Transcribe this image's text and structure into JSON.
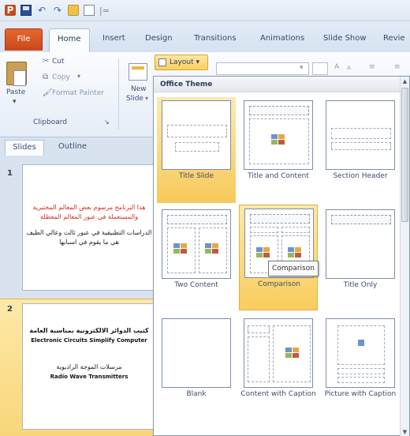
{
  "qat": {
    "separator": "|="
  },
  "tabs": {
    "file": "File",
    "home": "Home",
    "insert": "Insert",
    "design": "Design",
    "transitions": "Transitions",
    "animations": "Animations",
    "slide_show": "Slide Show",
    "review": "Revie"
  },
  "ribbon": {
    "cut": "Cut",
    "copy": "Copy",
    "paste": "Paste",
    "format_painter": "Format Painter",
    "new_slide_line1": "New",
    "new_slide_line2": "Slide",
    "clipboard_group": "Clipboard",
    "layout_button": "Layout"
  },
  "left_pane": {
    "tab_slides": "Slides",
    "tab_outline": "Outline",
    "slides": [
      {
        "number": "1",
        "line1": "هذا البرنامج مرسوم بعض المعالم المختبرية",
        "line2": "والمستعملة في عبور المعالم المعطلة",
        "line3": "الدراسات التطبيقية في عبور ثالث وعالي الطيف",
        "line4": "هي ما يقوم في اسبابها"
      },
      {
        "number": "2",
        "line1": "كتيب الدوائر الالكترونية بمناسبة العامة",
        "line2": "Electronic Circuits Simplify Computer",
        "line3": "مرسلات الموجة الراديوية",
        "line4": "Radio Wave Transmitters"
      }
    ]
  },
  "gallery": {
    "header": "Office Theme",
    "layouts": [
      "Title Slide",
      "Title and Content",
      "Section Header",
      "Two Content",
      "Comparison",
      "Title Only",
      "Blank",
      "Content with Caption",
      "Picture with Caption"
    ],
    "tooltip": "Comparison"
  },
  "colors": {
    "accent": "#f9cd5e",
    "file_tab": "#d8531f",
    "ribbon": "#e5edf7"
  }
}
